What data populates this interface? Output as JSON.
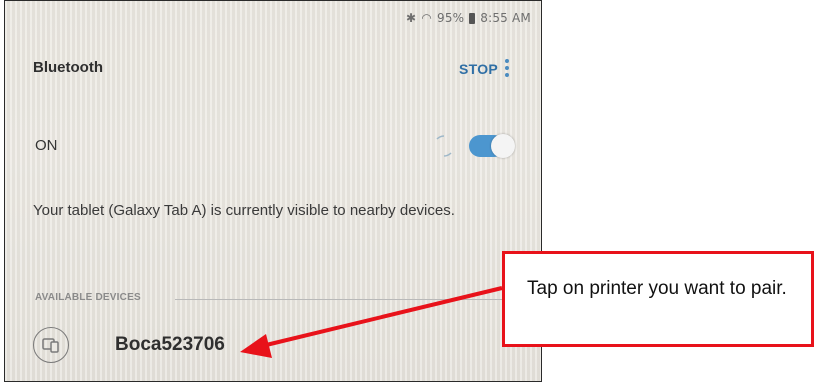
{
  "status_bar": {
    "icons": [
      "bluetooth-icon",
      "wifi-icon",
      "battery-icon"
    ],
    "battery": "95%",
    "time": "8:55 AM"
  },
  "header": {
    "title": "Bluetooth",
    "stop_label": "STOP",
    "more_icon": "more-vertical-icon"
  },
  "bluetooth_toggle": {
    "label": "ON",
    "state": true
  },
  "visibility_notice": "Your tablet (Galaxy Tab A) is currently visible to nearby devices.",
  "available_devices": {
    "header": "AVAILABLE DEVICES",
    "items": [
      {
        "name": "Boca523706",
        "icon": "device-icon"
      }
    ]
  },
  "annotation": {
    "text": "Tap on printer you want to pair.",
    "color": "#e8121a"
  },
  "colors": {
    "accent": "#4c96cf",
    "stop": "#2f6fa5"
  }
}
